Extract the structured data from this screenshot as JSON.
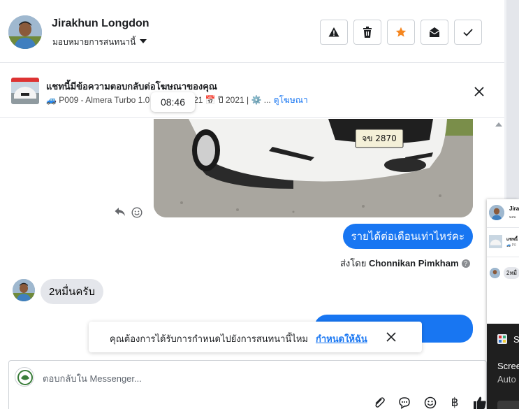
{
  "header": {
    "contact_name": "Jirakhun Longdon",
    "assign_label": "มอบหมายการสนทนานี้",
    "buttons": [
      {
        "name": "spam-button",
        "icon": "warning-icon"
      },
      {
        "name": "delete-button",
        "icon": "trash-icon"
      },
      {
        "name": "star-button",
        "icon": "star-icon",
        "color": "#f5861f"
      },
      {
        "name": "mark-unread-button",
        "icon": "open-envelope-icon"
      },
      {
        "name": "mark-done-button",
        "icon": "checkmark-icon"
      }
    ]
  },
  "ad_banner": {
    "title": "แชทนี้มีข้อความตอบกลับต่อโฆษณาของคุณ",
    "info": "🚙 P009 - Almera Turbo 1.0 ... AT* ปี 2021 📅 ปี 2021 | ⚙️ ...",
    "view_ad_link": "ดูโฆษณา"
  },
  "timestamp": "08:46",
  "messages": {
    "outgoing_1": "รายได้ต่อเดือนเท่าไหร่คะ",
    "sent_by_prefix": "ส่งโดย",
    "sent_by_name": "Chonnikan Pimkham",
    "incoming_1": "2หมื่นครับ"
  },
  "car_plate": "จข 2870",
  "toast": {
    "text": "คุณต้องการได้รับการกำหนดไปยังการสนทนานี้ไหม",
    "link": "กำหนดให้ฉัน"
  },
  "composer": {
    "placeholder": "ตอบกลับใน Messenger...",
    "tools": [
      "attachment-icon",
      "saved-reply-icon",
      "emoji-icon",
      "baht-payment-icon",
      "thumbs-up-icon"
    ],
    "baht_glyph": "฿"
  },
  "side_panel": {
    "name": "Jira",
    "sub": "มอบ",
    "ad_title": "แชทนี้",
    "ad_info": "🚙 P0",
    "bubble": "2หมื่"
  },
  "dark_panel": {
    "letter": "S",
    "line1": "Scree",
    "line2": "Auto"
  }
}
